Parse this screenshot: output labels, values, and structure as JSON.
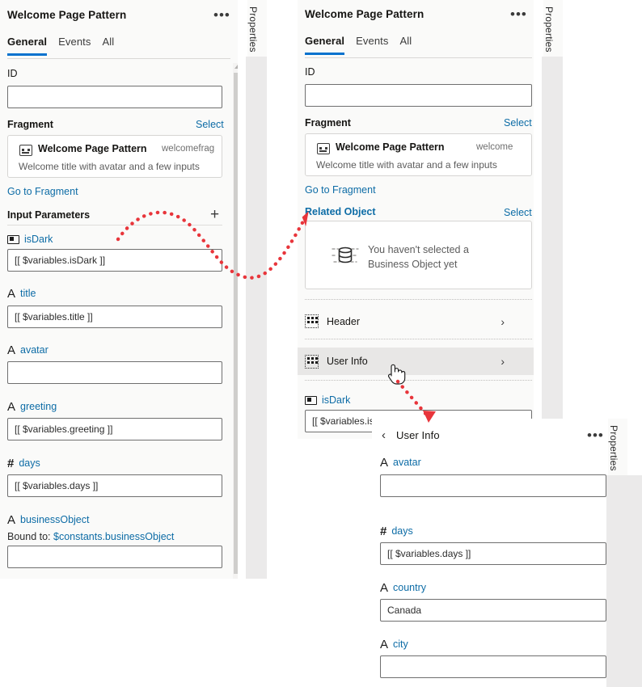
{
  "colors": {
    "accent": "#0572ce",
    "link": "#0d6ca6",
    "panel_bg": "#fafaf9",
    "annotation": "#e8353b",
    "highlight_row": "#e8e7e6"
  },
  "panel1": {
    "title": "Welcome Page Pattern",
    "overflow_label": "•••",
    "properties_tab": "Properties",
    "tabs": [
      {
        "label": "General",
        "active": true
      },
      {
        "label": "Events",
        "active": false
      },
      {
        "label": "All",
        "active": false
      }
    ],
    "id_label": "ID",
    "id_value": "",
    "fragment_label": "Fragment",
    "fragment_select": "Select",
    "fragment_card": {
      "icon": "fragment-icon",
      "name": "Welcome Page Pattern",
      "id": "welcomefrag",
      "description": "Welcome title with avatar and a few inputs"
    },
    "go_to_fragment": "Go to Fragment",
    "input_parameters_label": "Input Parameters",
    "add_label": "+",
    "parameters": [
      {
        "icon": "boolean-icon",
        "name": "isDark",
        "value": "[[ $variables.isDark ]]"
      },
      {
        "icon": "string-icon",
        "name": "title",
        "value": "[[ $variables.title ]]"
      },
      {
        "icon": "string-icon",
        "name": "avatar",
        "value": ""
      },
      {
        "icon": "string-icon",
        "name": "greeting",
        "value": "[[ $variables.greeting ]]"
      },
      {
        "icon": "number-icon",
        "name": "days",
        "value": "[[ $variables.days ]]"
      },
      {
        "icon": "string-icon",
        "name": "businessObject",
        "value": "",
        "bound_prefix": "Bound to: ",
        "bound_to": "$constants.businessObject"
      }
    ]
  },
  "panel2": {
    "title": "Welcome Page Pattern",
    "overflow_label": "•••",
    "properties_tab": "Properties",
    "tabs": [
      {
        "label": "General",
        "active": true
      },
      {
        "label": "Events",
        "active": false
      },
      {
        "label": "All",
        "active": false
      }
    ],
    "id_label": "ID",
    "id_value": "",
    "fragment_label": "Fragment",
    "fragment_select": "Select",
    "fragment_card": {
      "icon": "fragment-icon",
      "name": "Welcome Page Pattern",
      "id": "welcome",
      "description": "Welcome title with avatar and a few inputs"
    },
    "go_to_fragment": "Go to Fragment",
    "related_object_label": "Related Object",
    "related_object_select": "Select",
    "related_object_empty": "You haven't selected a Business Object yet",
    "nav_rows": [
      {
        "icon": "grid-icon",
        "label": "Header",
        "highlighted": false,
        "chevron": "›"
      },
      {
        "icon": "grid-icon",
        "label": "User Info",
        "highlighted": true,
        "chevron": "›"
      }
    ],
    "parameter": {
      "icon": "boolean-icon",
      "name": "isDark",
      "value": "[[ $variables.is"
    }
  },
  "panel3": {
    "back_chevron": "‹",
    "title": "User Info",
    "overflow_label": "•••",
    "properties_tab": "Properties",
    "fields": [
      {
        "icon": "string-icon",
        "name": "avatar",
        "value": ""
      },
      {
        "icon": "number-icon",
        "name": "days",
        "value": "[[ $variables.days ]]"
      },
      {
        "icon": "string-icon",
        "name": "country",
        "value": "Canada"
      },
      {
        "icon": "string-icon",
        "name": "city",
        "value": ""
      }
    ]
  },
  "annotations": {
    "arrow1_desc": "curve-from-input-parameters-to-related-object",
    "arrow2_desc": "arrow-from-user-info-row-to-user-info-panel",
    "cursor": "pointer-hand-cursor"
  }
}
